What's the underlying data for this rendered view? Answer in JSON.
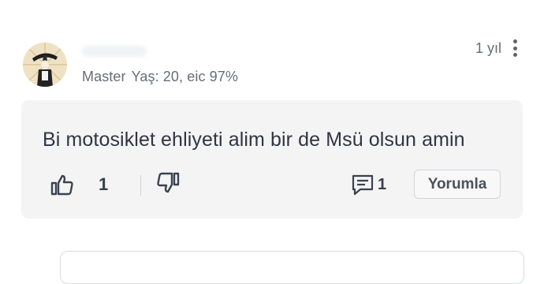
{
  "comment": {
    "user": {
      "rank": "Master",
      "age_score": "Yaş: 20, eic 97%"
    },
    "time_ago": "1 yıl",
    "text": "Bi motosiklet ehliyeti alim bir de Msü olsun amin",
    "likes": "1",
    "replies": "1",
    "reply_button_label": "Yorumla"
  },
  "icons": {
    "avatar": "avatar-illustration",
    "more": "more-vertical-icon",
    "like": "thumbs-up-icon",
    "dislike": "thumbs-down-icon",
    "replies": "comment-icon"
  },
  "colors": {
    "card_background": "#f4f4f5",
    "text": "#2f3542",
    "muted_text": "#666d78",
    "icon": "#3b4250"
  }
}
